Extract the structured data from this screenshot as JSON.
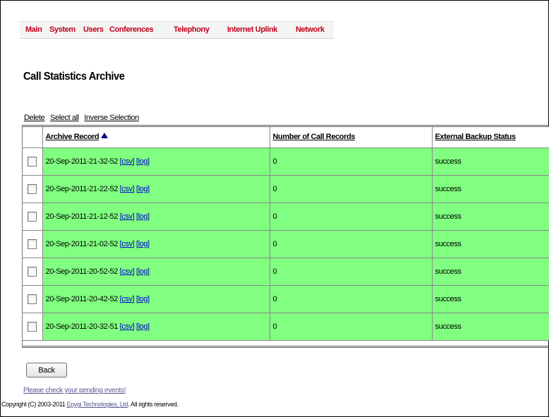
{
  "nav": {
    "items": [
      {
        "label": "Main"
      },
      {
        "label": "System"
      },
      {
        "label": "Users"
      },
      {
        "label": "Conferences"
      },
      {
        "label": "Telephony"
      },
      {
        "label": "Internet Uplink"
      },
      {
        "label": "Network"
      }
    ],
    "color": "#c1001a"
  },
  "page": {
    "title": "Call Statistics Archive"
  },
  "actions": {
    "delete": "Delete",
    "select_all": "Select all",
    "inverse_selection": "Inverse Selection"
  },
  "table": {
    "headers": {
      "archive_record": "Archive Record",
      "num_call_records": "Number of Call Records",
      "backup_status": "External Backup Status"
    },
    "sort": "ascending",
    "row_color": "#80ff80",
    "rows": [
      {
        "record": "20-Sep-2011-21-32-52",
        "csv": "[csv]",
        "log": "[log]",
        "count": "0",
        "status": "success"
      },
      {
        "record": "20-Sep-2011-21-22-52",
        "csv": "[csv]",
        "log": "[log]",
        "count": "0",
        "status": "success"
      },
      {
        "record": "20-Sep-2011-21-12-52",
        "csv": "[csv]",
        "log": "[log]",
        "count": "0",
        "status": "success"
      },
      {
        "record": "20-Sep-2011-21-02-52",
        "csv": "[csv]",
        "log": "[log]",
        "count": "0",
        "status": "success"
      },
      {
        "record": "20-Sep-2011-20-52-52",
        "csv": "[csv]",
        "log": "[log]",
        "count": "0",
        "status": "success"
      },
      {
        "record": "20-Sep-2011-20-42-52",
        "csv": "[csv]",
        "log": "[log]",
        "count": "0",
        "status": "success"
      },
      {
        "record": "20-Sep-2011-20-32-51",
        "csv": "[csv]",
        "log": "[log]",
        "count": "0",
        "status": "success"
      }
    ]
  },
  "footer": {
    "back": "Back",
    "pending": "Please check your pending events!",
    "copyright_prefix": "Copyright (C) 2003-2011 ",
    "copyright_company": "Epygi Technologies, Ltd",
    "copyright_suffix": ". All rights reserved."
  }
}
